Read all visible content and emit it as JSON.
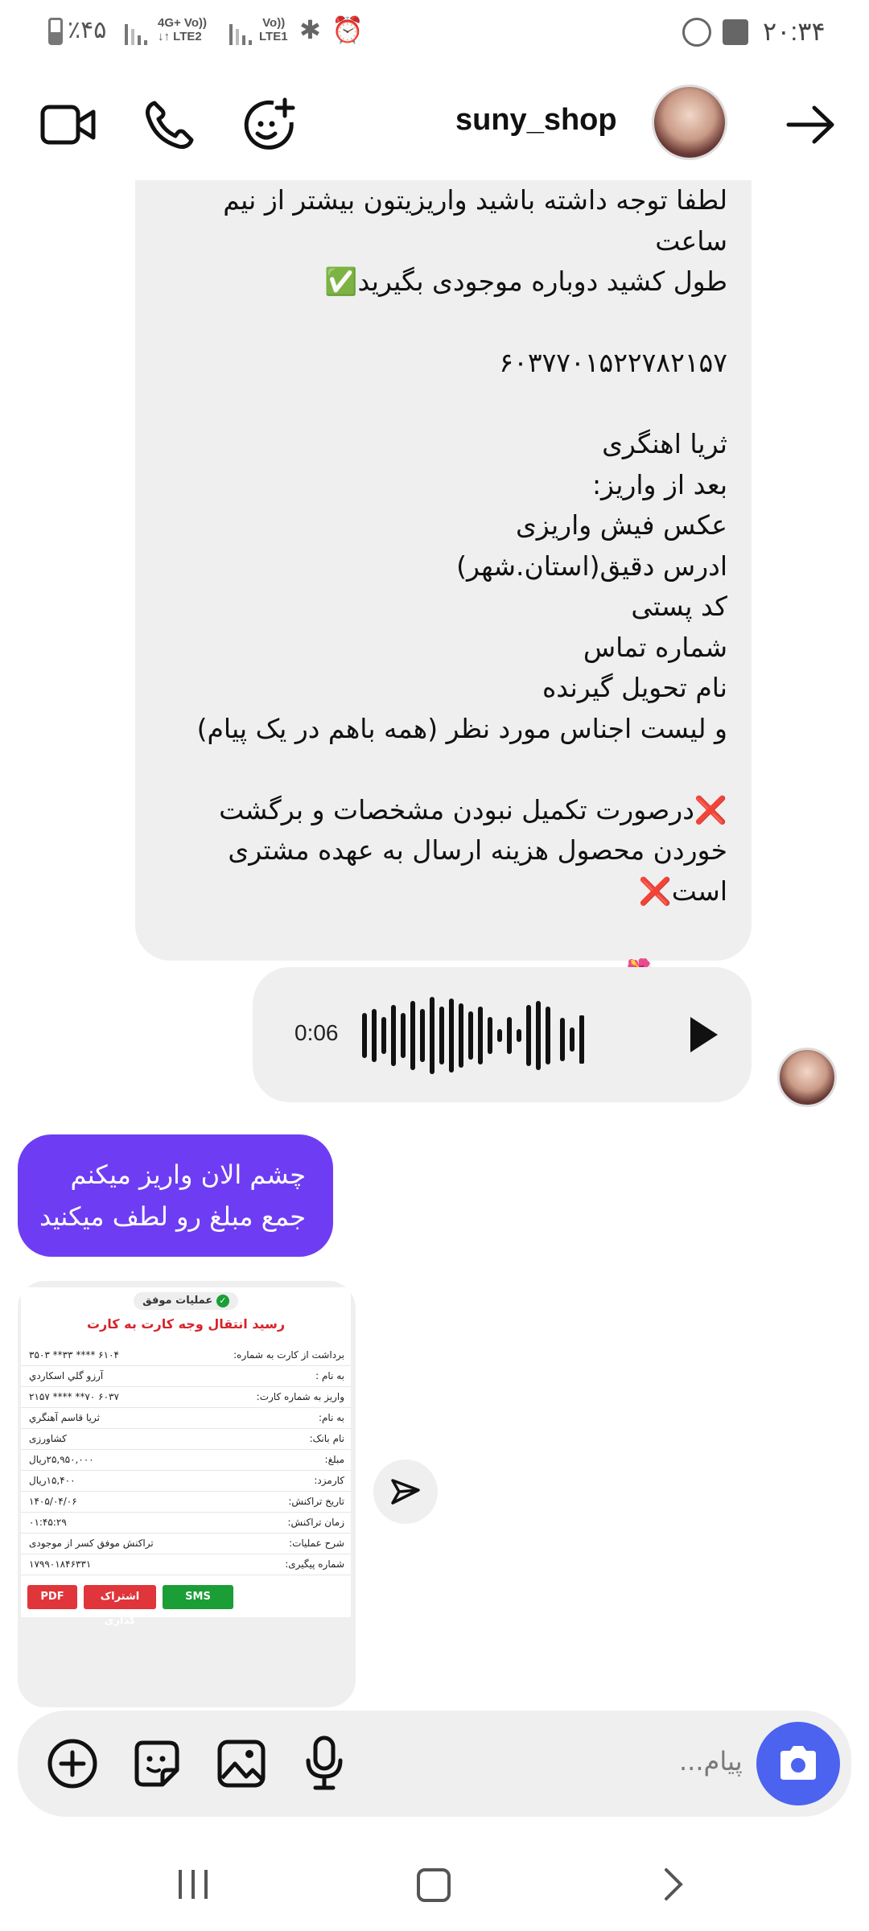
{
  "status_bar": {
    "battery": "٪۴۵",
    "time": "۲۰:۳۴",
    "network1": "4G+\nLTE2",
    "volte1": "Vo))",
    "network2": "LTE1",
    "volte2": "Vo))"
  },
  "header": {
    "username": "suny_shop",
    "icons": [
      "video-call-icon",
      "phone-icon",
      "add-person-icon",
      "back-arrow-icon"
    ]
  },
  "messages": {
    "incoming_text": "لطفا توجه داشته باشید واریزیتون بیشتر از نیم ساعت\nطول کشید دوباره موجودی بگیرید✅\n\n۶۰۳۷۷۰۱۵۲۲۷۸۲۱۵۷\n\nثریا اهنگری\nبعد از واریز:\nعکس فیش واریزی\nادرس دقیق(استان.شهر)\nکد پستی\nشماره تماس\nنام تحویل گیرنده\nو لیست اجناس مورد نظر (همه باهم در یک پیام)\n\n❌درصورت تکمیل نبودن مشخصات و برگشت\nخوردن محصول هزینه ارسال به عهده مشتری\nاست❌\n\nممنون🌺",
    "voice_duration": "0:06",
    "outgoing_text": "چشم الان واریز میکنم\nجمع مبلغ رو لطف میکنید"
  },
  "receipt": {
    "status_badge": "عملیات موفق",
    "title": "رسید انتقال وجه کارت به کارت",
    "rows": [
      {
        "label": "برداشت از کارت به شماره:",
        "value": "۶۱۰۴ ****  ۳۳** ۳۵۰۳"
      },
      {
        "label": "به نام :",
        "value": "آرزو گلي اسكاردي"
      },
      {
        "label": "واریز به شماره کارت:",
        "value": "۶۰۳۷ ۷۰** **** ۲۱۵۷"
      },
      {
        "label": "به نام:",
        "value": "ثريا قاسم آهنگري"
      },
      {
        "label": "نام بانک:",
        "value": "کشاورزی"
      },
      {
        "label": "مبلغ:",
        "value": "۲۵,۹۵۰,۰۰۰ریال"
      },
      {
        "label": "کارمزد:",
        "value": "۱۵,۴۰۰ریال"
      },
      {
        "label": "تاریخ تراکنش:",
        "value": "۱۴۰۵/۰۴/۰۶"
      },
      {
        "label": "زمان تراکنش:",
        "value": "۰۱:۴۵:۲۹"
      },
      {
        "label": "شرح عملیات:",
        "value": "تراکنش موفق کسر از موجودی"
      },
      {
        "label": "شماره پیگیری:",
        "value": "۱۷۹۹۰۱۸۴۶۳۳۱"
      }
    ],
    "buttons": {
      "sms": "SMS",
      "share": "اشتراک گذاری",
      "pdf": "PDF"
    },
    "colors": {
      "sms": "#1a9e35",
      "share": "#e0353a",
      "pdf": "#e0353a",
      "title": "#d8232a"
    }
  },
  "composer": {
    "placeholder": "پیام..."
  },
  "colors": {
    "outgoing_bubble": "#6e3df3",
    "incoming_bubble": "#efefef",
    "camera_button": "#4c63f0"
  }
}
